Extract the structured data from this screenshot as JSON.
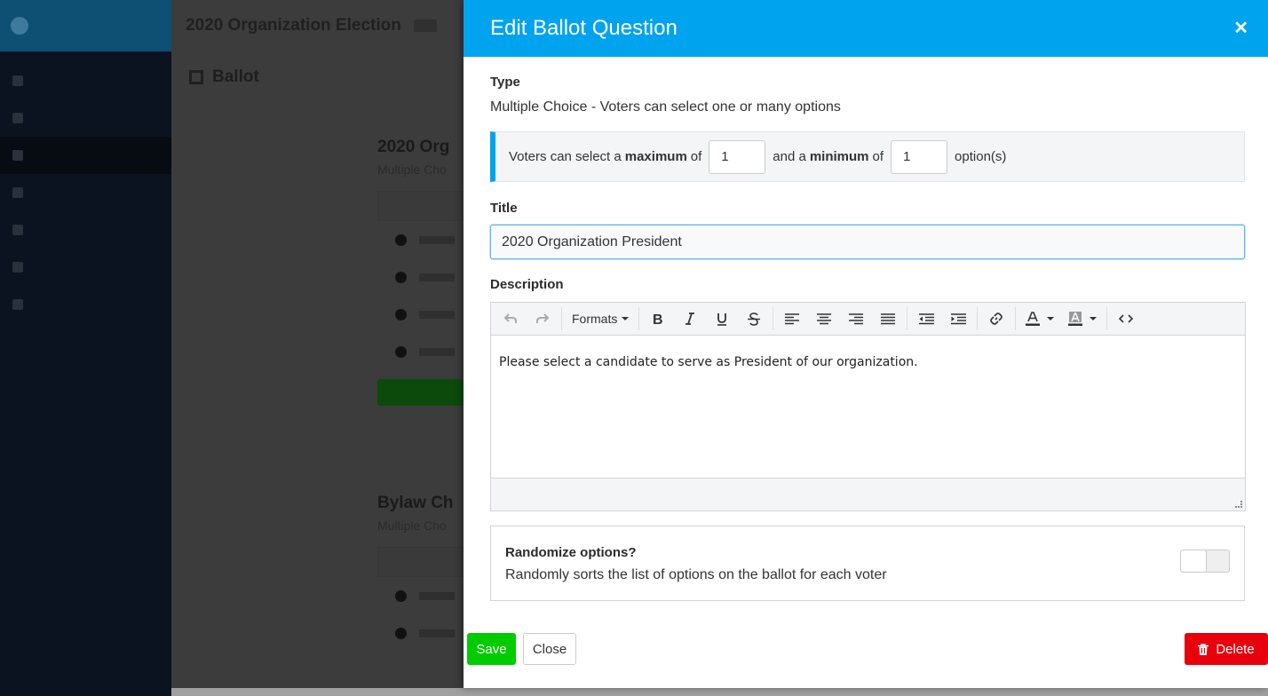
{
  "background": {
    "election_title": "2020 Organization Election",
    "section_title": "Ballot",
    "questions": [
      {
        "title": "2020 Org",
        "subtitle": "Multiple Cho"
      },
      {
        "title": "Bylaw Ch",
        "subtitle": "Multiple Cho"
      }
    ]
  },
  "modal": {
    "title": "Edit Ballot Question",
    "close_icon": "✕",
    "type_label": "Type",
    "type_value": "Multiple Choice - Voters can select one or many options",
    "limits": {
      "prefix": "Voters can select a",
      "maximum_word": "maximum",
      "of1": "of",
      "maximum_value": "1",
      "mid": "and a",
      "minimum_word": "minimum",
      "of2": "of",
      "minimum_value": "1",
      "suffix": "option(s)"
    },
    "title_label": "Title",
    "title_value": "2020 Organization President",
    "description_label": "Description",
    "toolbar": {
      "formats_label": "Formats"
    },
    "description_text": "Please select a candidate to serve as President of our organization.",
    "randomize": {
      "title": "Randomize options?",
      "description": "Randomly sorts the list of options on the ballot for each voter",
      "enabled": false
    },
    "buttons": {
      "save": "Save",
      "close": "Close",
      "delete": "Delete"
    }
  },
  "colors": {
    "header": "#00a3ee",
    "save": "#00cc00",
    "delete": "#e8000c"
  }
}
